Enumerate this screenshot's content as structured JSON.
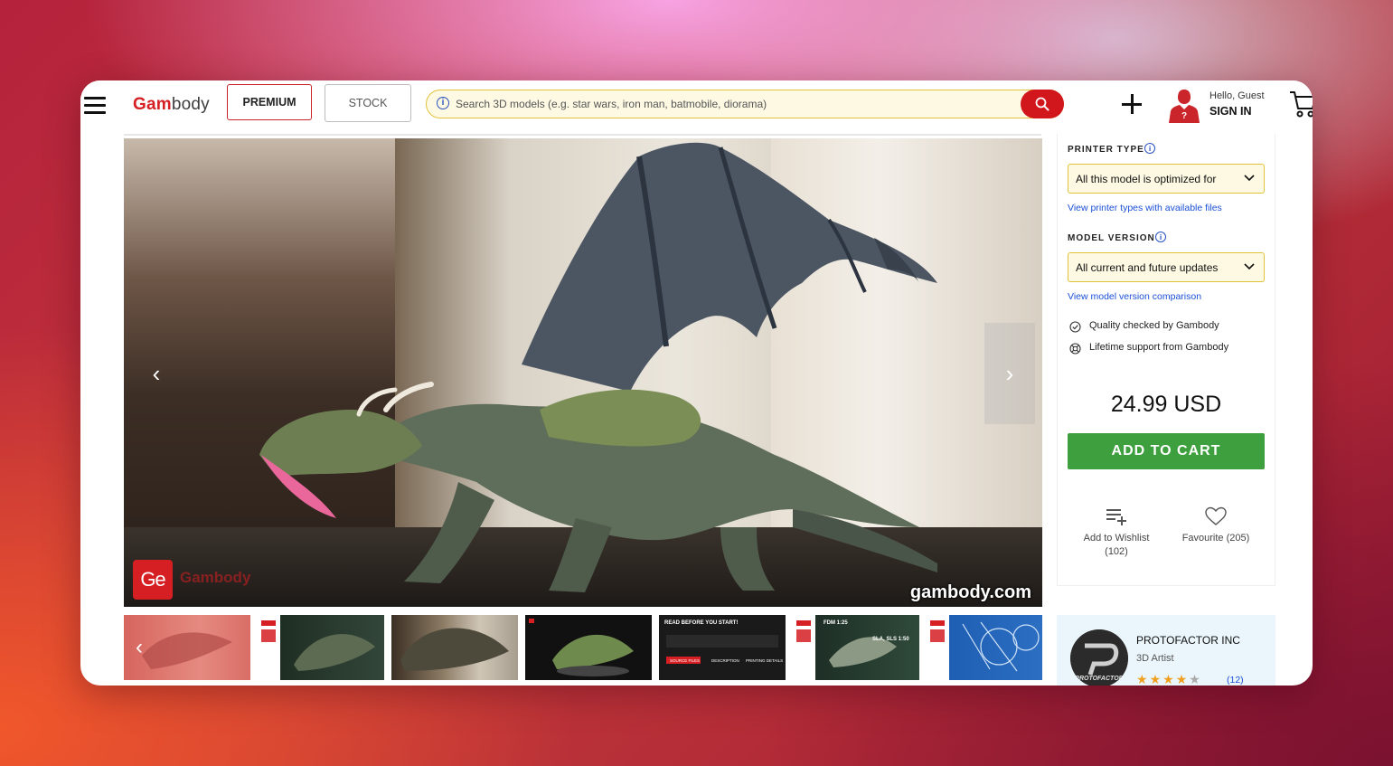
{
  "header": {
    "logo": {
      "part1": "Gam",
      "part2": "body"
    },
    "premium_label": "PREMIUM",
    "stock_label": "STOCK",
    "search": {
      "placeholder": "Search 3D models (e.g. star wars, iron man, batmobile, diorama)",
      "value": ""
    },
    "greeting": "Hello, Guest",
    "signin_label": "SIGN IN",
    "icons": [
      "menu-icon",
      "info-icon",
      "search-icon",
      "plus-icon",
      "guest-avatar-icon",
      "cart-icon"
    ]
  },
  "gallery": {
    "watermark": "gambody.com",
    "badge_text": "Ge",
    "badge_label": "Gambody",
    "thumbnails": [
      {
        "label": ""
      },
      {
        "label": ""
      },
      {
        "label": ""
      },
      {
        "label": ""
      },
      {
        "label": "READ BEFORE YOU START!",
        "buttons": [
          "SOURCE FILES",
          "DESCRIPTION",
          "PRINTING DETAILS"
        ]
      },
      {
        "label": "FDM 1:25",
        "label2": "SLA, SLS 1:50"
      },
      {
        "label": ""
      }
    ]
  },
  "sidebar": {
    "printer_type_label": "PRINTER TYPE",
    "printer_type_value": "All this model is optimized for",
    "printer_types_link": "View printer types with available files",
    "model_version_label": "MODEL VERSION",
    "model_version_value": "All current and future updates",
    "model_version_link": "View model version comparison",
    "features": [
      "Quality checked by Gambody",
      "Lifetime support from Gambody"
    ],
    "price": "24.99 USD",
    "add_to_cart_label": "ADD TO CART",
    "wishlist": {
      "label": "Add to Wishlist",
      "count": "(102)"
    },
    "favourite": {
      "label": "Favourite",
      "count": "(205)"
    }
  },
  "seller": {
    "name": "PROTOFACTOR INC",
    "role": "3D Artist",
    "rating": 4,
    "rating_max": 5,
    "rating_count": "(12)",
    "logo_text": "PROTOFACTOR"
  },
  "colors": {
    "brand_red": "#d51f23",
    "cart_green": "#3e9f3e",
    "link_blue": "#1a4fd6",
    "search_border": "#e0c33a"
  }
}
